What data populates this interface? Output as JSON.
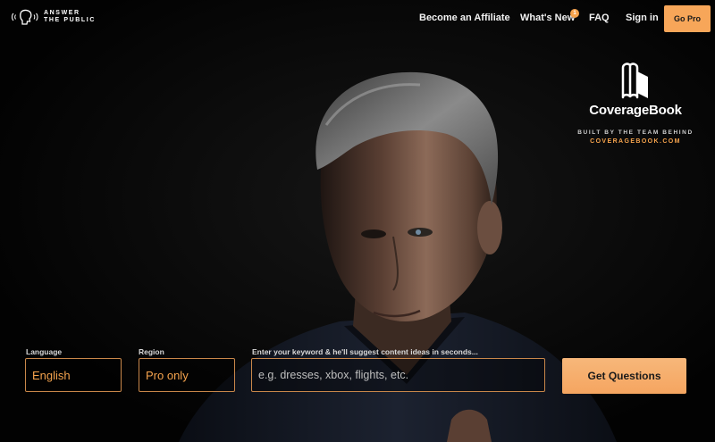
{
  "brand": {
    "logo_line1": "ANSWER",
    "logo_line2": "THE PUBLIC"
  },
  "nav": {
    "affiliate": "Become an Affiliate",
    "whats_new": "What's New",
    "whats_new_badge": "1",
    "faq": "FAQ",
    "sign_in": "Sign in",
    "go_pro": "Go Pro"
  },
  "promo": {
    "name": "CoverageBook",
    "built_by": "BUILT BY THE TEAM BEHIND",
    "link": "COVERAGEBOOK.COM",
    "icon": "book-icon"
  },
  "form": {
    "language_label": "Language",
    "language_value": "English",
    "region_label": "Region",
    "region_value": "Pro only",
    "keyword_label": "Enter your keyword & he'll suggest content ideas in seconds...",
    "keyword_placeholder": "e.g. dresses, xbox, flights, etc.",
    "submit": "Get Questions"
  },
  "colors": {
    "accent": "#f5a34d",
    "button": "#f7a659",
    "background": "#000000"
  }
}
